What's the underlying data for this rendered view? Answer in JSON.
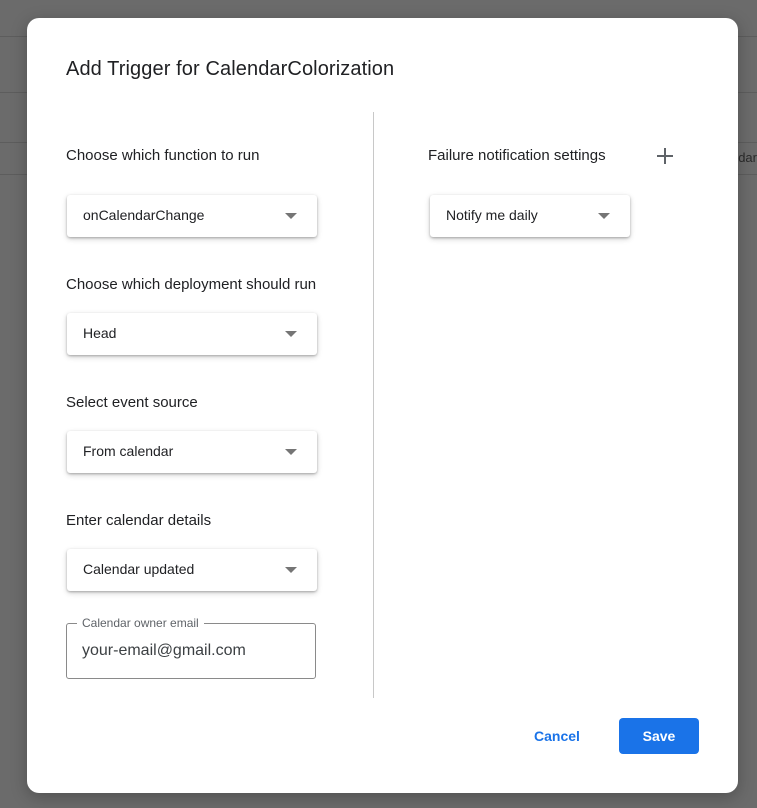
{
  "background": {
    "partial_text": "dar"
  },
  "dialog": {
    "title": "Add Trigger for CalendarColorization"
  },
  "left_column": {
    "function_label": "Choose which function to run",
    "function_value": "onCalendarChange",
    "deployment_label": "Choose which deployment should run",
    "deployment_value": "Head",
    "event_source_label": "Select event source",
    "event_source_value": "From calendar",
    "calendar_details_label": "Enter calendar details",
    "calendar_details_value": "Calendar updated",
    "owner_email_label": "Calendar owner email",
    "owner_email_value": "your-email@gmail.com"
  },
  "right_column": {
    "failure_label": "Failure notification settings",
    "failure_value": "Notify me daily",
    "add_icon": "plus-icon"
  },
  "footer": {
    "cancel_label": "Cancel",
    "save_label": "Save"
  },
  "colors": {
    "accent": "#1a73e8",
    "scrim": "#6b6b6b"
  }
}
